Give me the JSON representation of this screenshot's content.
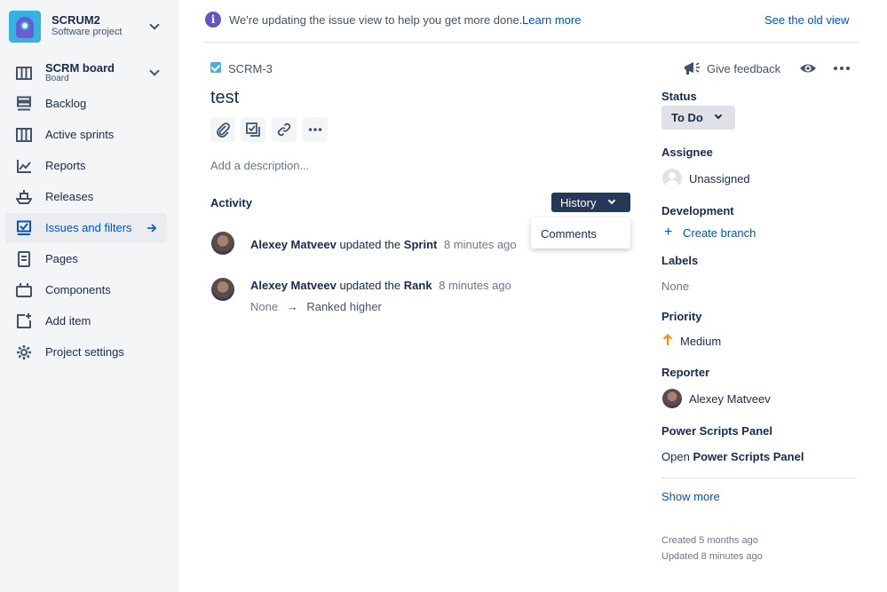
{
  "project": {
    "name": "SCRUM2",
    "type": "Software project"
  },
  "sidebar": {
    "board": {
      "label": "SCRM board",
      "sub": "Board"
    },
    "items": [
      {
        "label": "Backlog",
        "icon": "backlog-icon"
      },
      {
        "label": "Active sprints",
        "icon": "board-icon"
      },
      {
        "label": "Reports",
        "icon": "chart-icon"
      },
      {
        "label": "Releases",
        "icon": "ship-icon"
      },
      {
        "label": "Issues and filters",
        "icon": "issues-icon",
        "active": true
      },
      {
        "label": "Pages",
        "icon": "page-icon"
      },
      {
        "label": "Components",
        "icon": "components-icon"
      },
      {
        "label": "Add item",
        "icon": "add-item-icon"
      },
      {
        "label": "Project settings",
        "icon": "gear-icon"
      }
    ]
  },
  "banner": {
    "text": "We're updating the issue view to help you get more done.",
    "link": "Learn more",
    "old_view": "See the old view"
  },
  "issue": {
    "key": "SCRM-3",
    "title": "test",
    "description_placeholder": "Add a description..."
  },
  "activity": {
    "label": "Activity",
    "filter": "History",
    "dropdown_option": "Comments",
    "entries": [
      {
        "author": "Alexey Matveev",
        "action": "updated the",
        "field": "Sprint",
        "time": "8 minutes ago"
      },
      {
        "author": "Alexey Matveev",
        "action": "updated the",
        "field": "Rank",
        "time": "8 minutes ago",
        "from": "None",
        "to": "Ranked higher"
      }
    ]
  },
  "details": {
    "feedback": "Give feedback",
    "status_label": "Status",
    "status_value": "To Do",
    "assignee_label": "Assignee",
    "assignee_value": "Unassigned",
    "development_label": "Development",
    "create_branch": "Create branch",
    "labels_label": "Labels",
    "labels_value": "None",
    "priority_label": "Priority",
    "priority_value": "Medium",
    "reporter_label": "Reporter",
    "reporter_value": "Alexey Matveev",
    "power_label": "Power Scripts Panel",
    "power_open_prefix": "Open",
    "power_open_name": "Power Scripts Panel",
    "show_more": "Show more",
    "created": "Created 5 months ago",
    "updated": "Updated 8 minutes ago"
  },
  "colors": {
    "accent": "#0052cc",
    "sidebar": "#f4f5f7",
    "history_btn": "#253858",
    "priority_medium": "#ff8b00"
  }
}
